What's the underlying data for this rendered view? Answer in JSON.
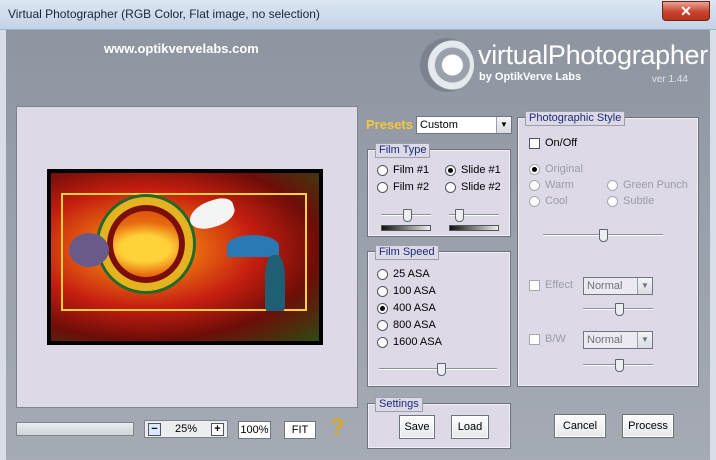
{
  "window": {
    "title": "Virtual Photographer (RGB Color, Flat image, no selection)",
    "close_glyph": "✕"
  },
  "header": {
    "site_url": "www.optikvervelabs.com",
    "logo_title": "virtualPhotographer",
    "logo_sub": "by OptikVerve Labs",
    "version": "ver 1.44"
  },
  "presets": {
    "label": "Presets",
    "selected": "Custom"
  },
  "film_type": {
    "legend": "Film Type",
    "options": [
      {
        "label": "Film #1",
        "selected": false
      },
      {
        "label": "Slide #1",
        "selected": true
      },
      {
        "label": "Film #2",
        "selected": false
      },
      {
        "label": "Slide #2",
        "selected": false
      }
    ]
  },
  "film_speed": {
    "legend": "Film Speed",
    "options": [
      {
        "label": "25 ASA",
        "selected": false
      },
      {
        "label": "100 ASA",
        "selected": false
      },
      {
        "label": "400 ASA",
        "selected": true
      },
      {
        "label": "800 ASA",
        "selected": false
      },
      {
        "label": "1600 ASA",
        "selected": false
      }
    ]
  },
  "photographic_style": {
    "legend": "Photographic Style",
    "onoff_label": "On/Off",
    "options": [
      {
        "label": "Original",
        "selected": true
      },
      {
        "label": "Warm",
        "selected": false
      },
      {
        "label": "Cool",
        "selected": false
      },
      {
        "label": "Green Punch",
        "selected": false
      },
      {
        "label": "Subtle",
        "selected": false
      }
    ],
    "effect_label": "Effect",
    "effect_value": "Normal",
    "bw_label": "B/W",
    "bw_value": "Normal"
  },
  "settings": {
    "legend": "Settings",
    "save": "Save",
    "load": "Load"
  },
  "zoom": {
    "minus": "−",
    "value": "25%",
    "plus": "+",
    "hundred": "100%",
    "fit": "FIT",
    "help": "?"
  },
  "actions": {
    "cancel": "Cancel",
    "process": "Process"
  },
  "colors": {
    "presets_label": "#f2c93a",
    "legend_text": "#1c2a7a",
    "help_icon": "#d8a829"
  }
}
